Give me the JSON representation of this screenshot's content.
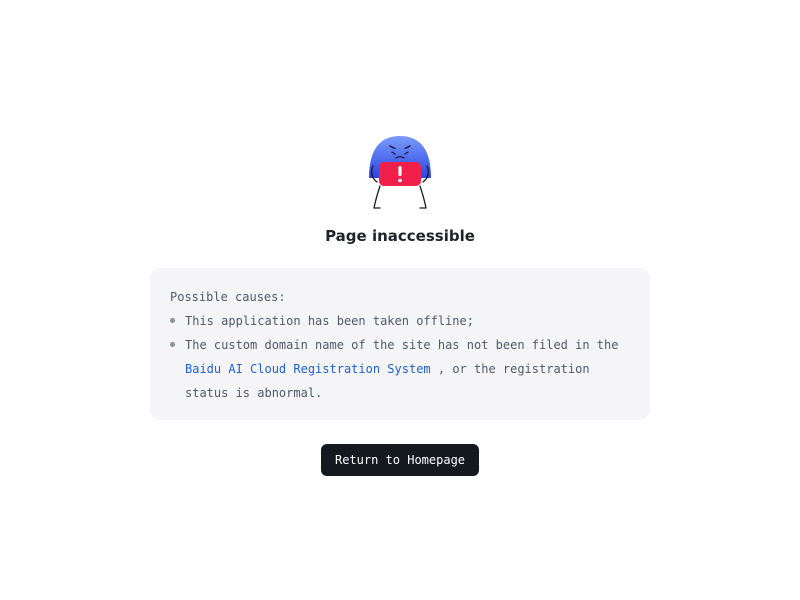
{
  "error": {
    "mascot_icon": "warning-mascot-icon",
    "title": "Page inaccessible"
  },
  "causes": {
    "heading": "Possible causes:",
    "item1": "This application has been taken offline;",
    "item2_before": "The custom domain name of the site has not been filed in the ",
    "item2_link": "Baidu AI Cloud Registration System",
    "item2_after": " , or the registration status is abnormal."
  },
  "actions": {
    "home_button": "Return to Homepage"
  },
  "colors": {
    "mascot_blue": "#3b5cf0",
    "alert_red": "#f0204a",
    "link": "#1f5ed8",
    "button_bg": "#14191f"
  }
}
